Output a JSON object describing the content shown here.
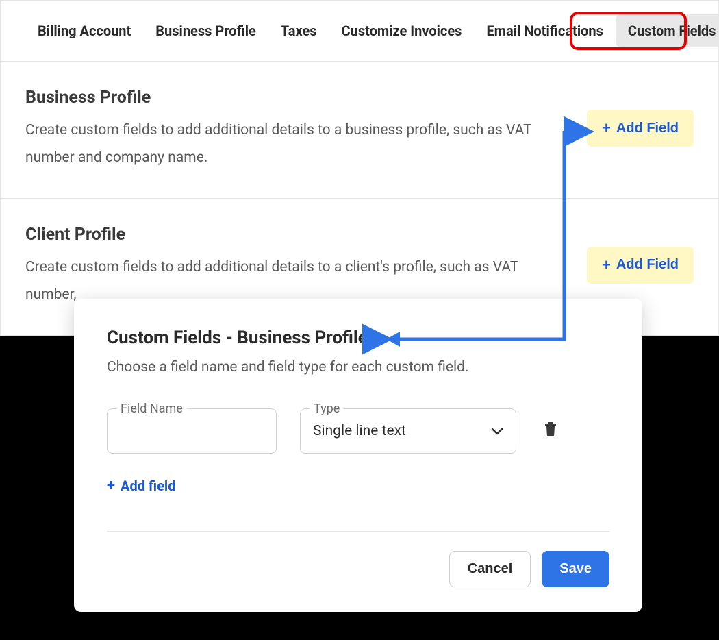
{
  "tabs": {
    "items": [
      {
        "label": "Billing Account"
      },
      {
        "label": "Business Profile"
      },
      {
        "label": "Taxes"
      },
      {
        "label": "Customize Invoices"
      },
      {
        "label": "Email Notifications"
      },
      {
        "label": "Custom Fields"
      }
    ]
  },
  "sections": {
    "business_profile": {
      "title": "Business Profile",
      "desc": "Create custom fields to add additional details to a business profile, such as VAT number and company name.",
      "add_label": "Add Field"
    },
    "client_profile": {
      "title": "Client Profile",
      "desc": "Create custom fields to add additional details to a client's profile, such as VAT number,",
      "add_label": "Add Field"
    }
  },
  "modal": {
    "title": "Custom Fields - Business Profile",
    "desc": "Choose a field name and field type for each custom field.",
    "field_name_label": "Field Name",
    "field_name_value": "",
    "type_label": "Type",
    "type_value": "Single line text",
    "add_field_label": "Add field",
    "cancel_label": "Cancel",
    "save_label": "Save"
  },
  "colors": {
    "accent_blue": "#1a5ad6",
    "primary_blue": "#2e74e6",
    "highlight_yellow": "#fff8c5",
    "callout_red": "#e60000"
  }
}
